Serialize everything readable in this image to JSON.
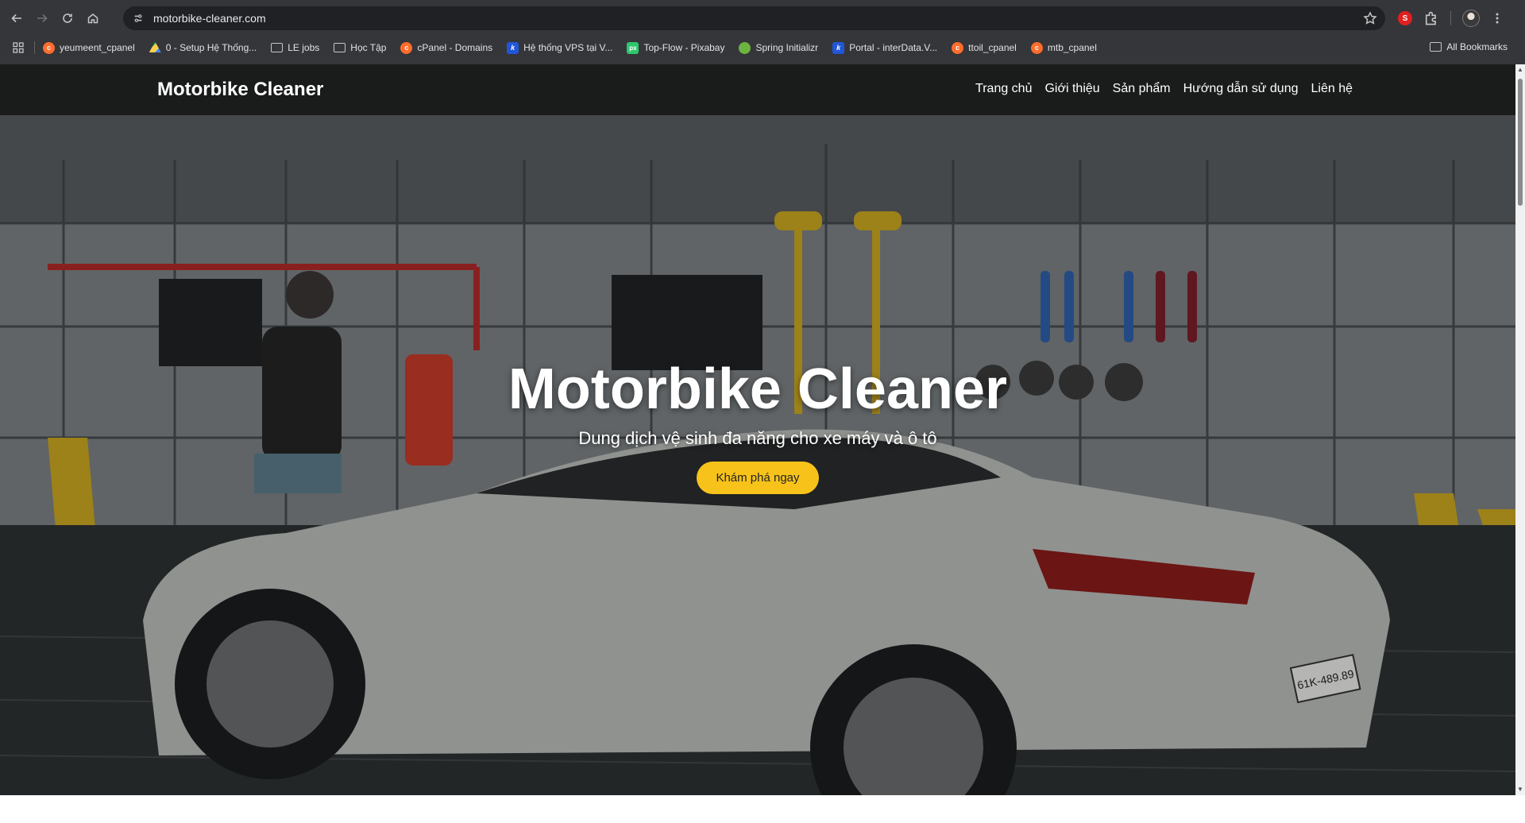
{
  "browser": {
    "url": "motorbike-cleaner.com",
    "extension_badge": "S",
    "bookmarks": [
      {
        "label": "yeumeent_cpanel",
        "icon": "cpanel-icon"
      },
      {
        "label": "0 - Setup Hệ Thống...",
        "icon": "drive-icon"
      },
      {
        "label": "LE jobs",
        "icon": "folder-icon"
      },
      {
        "label": "Học Tập",
        "icon": "folder-icon"
      },
      {
        "label": "cPanel - Domains",
        "icon": "cpanel-icon"
      },
      {
        "label": "Hệ thống VPS tại V...",
        "icon": "k-icon"
      },
      {
        "label": "Top-Flow - Pixabay",
        "icon": "pixabay-icon"
      },
      {
        "label": "Spring Initializr",
        "icon": "spring-icon"
      },
      {
        "label": "Portal - interData.V...",
        "icon": "k-icon"
      },
      {
        "label": "ttoil_cpanel",
        "icon": "cpanel-icon"
      },
      {
        "label": "mtb_cpanel",
        "icon": "cpanel-icon"
      }
    ],
    "all_bookmarks": "All Bookmarks"
  },
  "site": {
    "brand": "Motorbike Cleaner",
    "menu": [
      "Trang chủ",
      "Giới thiệu",
      "Sản phẩm",
      "Hướng dẫn sử dụng",
      "Liên hệ"
    ]
  },
  "hero": {
    "title": "Motorbike Cleaner",
    "subtitle": "Dung dịch vệ sinh đa năng cho xe máy và ô tô",
    "cta": "Khám phá ngay",
    "plate_text": "61K-489.89"
  },
  "colors": {
    "accent": "#f7c31a",
    "nav_bg": "#141414",
    "chrome_bg": "#35363a"
  }
}
